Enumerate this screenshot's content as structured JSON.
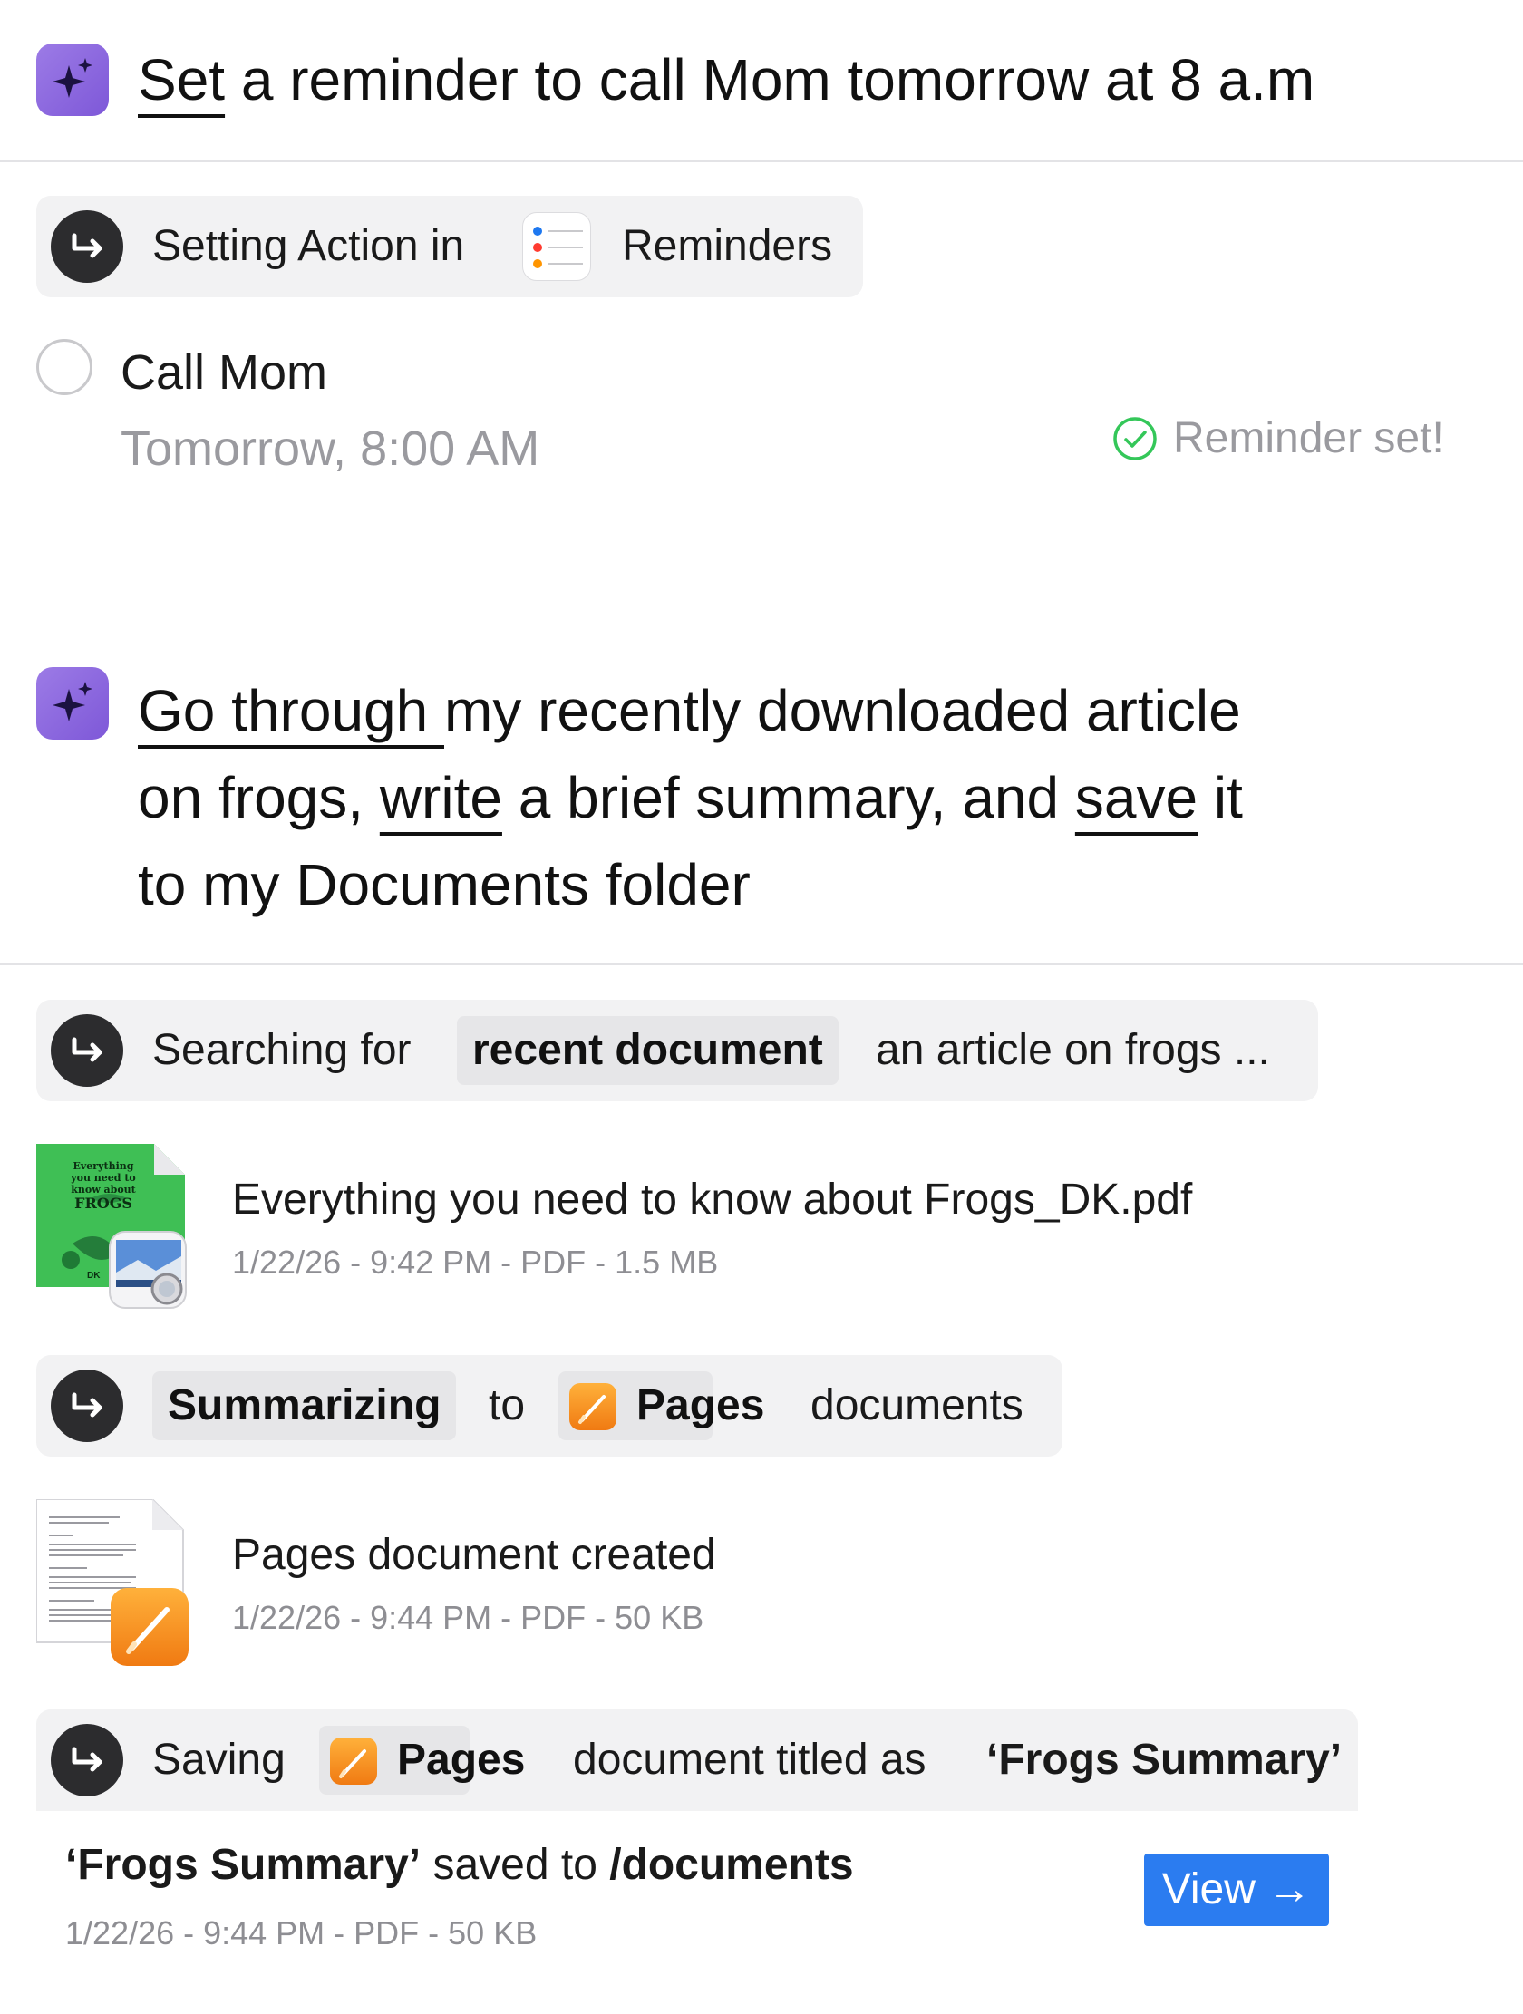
{
  "prompt1": {
    "verb": "Set",
    "rest": " a reminder to call Mom tomorrow at 8 a.m"
  },
  "action1": {
    "prefix": "Setting Action in",
    "app_name": "Reminders",
    "app_icon": "reminders-icon"
  },
  "reminder": {
    "title": "Call Mom",
    "time": "Tomorrow, 8:00 AM",
    "status": "Reminder set!",
    "status_color": "#34c759"
  },
  "prompt2": {
    "seg1": "Go through ",
    "seg2": "my recently downloaded article",
    "seg3": "on frogs, ",
    "seg4": "write",
    "seg5": " a brief summary, and ",
    "seg6": "save",
    "seg7": " it",
    "seg8": "to my Documents folder"
  },
  "action2": {
    "prefix": "Searching for",
    "chip": "recent document",
    "suffix": "an article on frogs ..."
  },
  "file1": {
    "name": "Everything you need to know about Frogs_DK.pdf",
    "meta": "1/22/26 - 9:42 PM - PDF - 1.5 MB",
    "thumb_lines": [
      "Everything",
      "you need to",
      "know about",
      "FROGS"
    ],
    "thumb_publisher": "DK",
    "badge_icon": "preview-app-icon"
  },
  "action3": {
    "chip": "Summarizing",
    "middle": "to",
    "app_chip": "Pages",
    "suffix": "documents",
    "app_icon": "pages-icon"
  },
  "file2": {
    "name": "Pages document created",
    "meta": "1/22/26 - 9:44 PM - PDF - 50 KB",
    "badge_icon": "pages-icon"
  },
  "action4": {
    "prefix": "Saving",
    "app_chip": "Pages",
    "middle": "document titled as",
    "title": "‘Frogs Summary’",
    "app_icon": "pages-icon"
  },
  "result": {
    "name": "‘Frogs Summary’",
    "middle": " saved to ",
    "path": "/documents",
    "meta": "1/22/26 - 9:44 PM - PDF - 50 KB",
    "button_label": "View →",
    "button_color": "#2b7cf0"
  },
  "colors": {
    "ai_icon": "#8a65de",
    "pill_bg": "#f2f2f3",
    "chip_bg": "#e6e6e8",
    "pages_orange": "#f5891e"
  }
}
